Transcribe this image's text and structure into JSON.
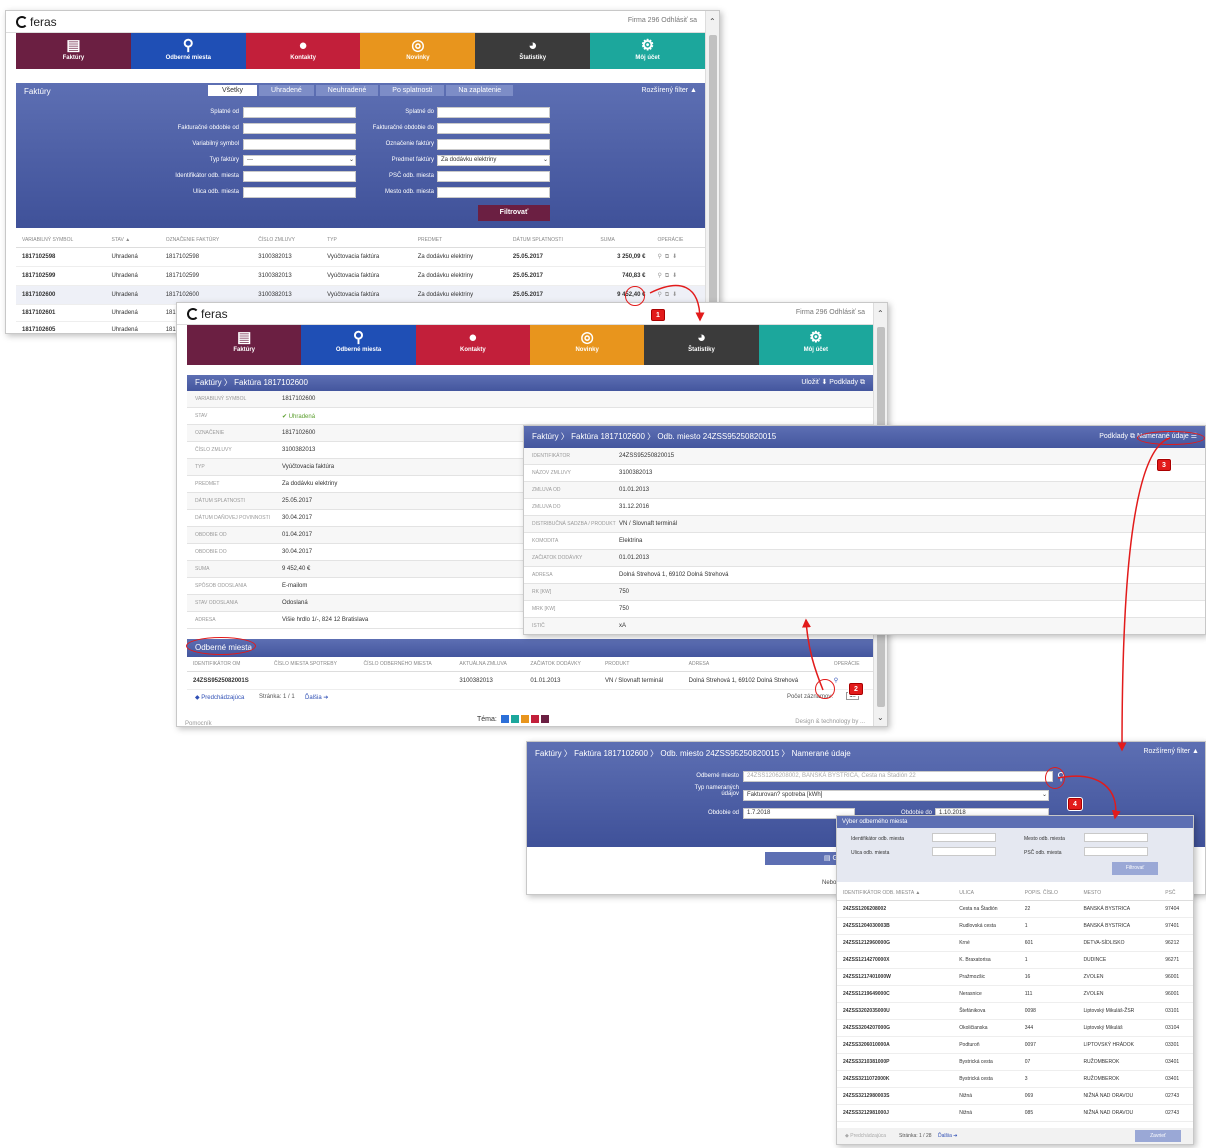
{
  "brand": "feras",
  "user_links": "Firma 296 Odhlásiť sa",
  "nav": [
    {
      "label": "Faktúry",
      "icon": "invoices-icon",
      "glyph": "▤",
      "color": "#6b1f42"
    },
    {
      "label": "Odberné miesta",
      "icon": "location-icon",
      "glyph": "⚲",
      "color": "#1f4fb5"
    },
    {
      "label": "Kontakty",
      "icon": "contact-icon",
      "glyph": "👤",
      "color": "#c21f3a"
    },
    {
      "label": "Novinky",
      "icon": "rss-icon",
      "glyph": "◎",
      "color": "#e8951d"
    },
    {
      "label": "Štatistiky",
      "icon": "pie-chart-icon",
      "glyph": "◕",
      "color": "#3b3b3b"
    },
    {
      "label": "Môj účet",
      "icon": "gears-icon",
      "glyph": "⚙",
      "color": "#1ca79c"
    }
  ],
  "s1": {
    "title": "Faktúry",
    "filter_label": "Rozšírený filter ▲",
    "tabs": [
      "Všetky",
      "Uhradené",
      "Neuhradené",
      "Po splatnosti",
      "Na zaplatenie"
    ],
    "labels_left": [
      "Splatné od",
      "Fakturačné obdobie od",
      "Variabilný symbol",
      "Typ faktúry",
      "Identifikátor odb. miesta",
      "Ulica odb. miesta"
    ],
    "labels_right": [
      "Splatné do",
      "Fakturačné obdobie do",
      "Označenie faktúry",
      "Predmet faktúry",
      "PSČ odb. miesta",
      "Mesto odb. miesta"
    ],
    "typ_value": "---",
    "predmet_value": "Za dodávku elektriny",
    "filter_button": "Filtrovať",
    "headers": [
      "VARIABILNÝ SYMBOL",
      "STAV ▲",
      "OZNAČENIE FAKTÚRY",
      "ČÍSLO ZMLUVY",
      "TYP",
      "PREDMET",
      "DÁTUM SPLATNOSTI",
      "SUMA",
      "OPERÁCIE"
    ],
    "rows": [
      [
        "1817102598",
        "Uhradená",
        "1817102598",
        "3100382013",
        "Vyúčtovacia faktúra",
        "Za dodávku elektriny",
        "25.05.2017",
        "3 250,09 €"
      ],
      [
        "1817102599",
        "Uhradená",
        "1817102599",
        "3100382013",
        "Vyúčtovacia faktúra",
        "Za dodávku elektriny",
        "25.05.2017",
        "740,83 €"
      ],
      [
        "1817102600",
        "Uhradená",
        "1817102600",
        "3100382013",
        "Vyúčtovacia faktúra",
        "Za dodávku elektriny",
        "25.05.2017",
        "9 452,40 €"
      ],
      [
        "1817102601",
        "Uhradená",
        "1817I",
        "",
        "",
        "",
        "",
        ""
      ],
      [
        "1817102605",
        "Uhradená",
        "1817I",
        "",
        "",
        "",
        "",
        ""
      ]
    ]
  },
  "s2": {
    "breadcrumb": "Faktúry  〉 Faktúra 1817102600",
    "actions": "Uložiť ⬇   Podklady ⧉",
    "details": [
      [
        "VARIABILNÝ SYMBOL",
        "1817102600"
      ],
      [
        "STAV",
        "✔ Uhradená"
      ],
      [
        "OZNAČENIE",
        "1817102600"
      ],
      [
        "ČÍSLO ZMLUVY",
        "3100382013"
      ],
      [
        "TYP",
        "Vyúčtovacia faktúra"
      ],
      [
        "PREDMET",
        "Za dodávku elektriny"
      ],
      [
        "DÁTUM SPLATNOSTI",
        "25.05.2017"
      ],
      [
        "DÁTUM DAŇOVEJ POVINNOSTI",
        "30.04.2017"
      ],
      [
        "OBDOBIE OD",
        "01.04.2017"
      ],
      [
        "OBDOBIE DO",
        "30.04.2017"
      ],
      [
        "SUMA",
        "9 452,40 €"
      ],
      [
        "SPÔSOB ODOSLANIA",
        "E-mailom"
      ],
      [
        "STAV ODOSLANIA",
        "Odoslaná"
      ],
      [
        "ADRESA",
        "Višie hrdlo 1/-, 824 12 Bratislava"
      ]
    ],
    "om_title": "Odberné miesta",
    "om_headers": [
      "IDENTIFIKÁTOR OM",
      "ČÍSLO MIESTA SPOTREBY",
      "ČÍSLO ODBERNÉHO MIESTA",
      "AKTUÁLNA ZMLUVA",
      "ZAČIATOK DODÁVKY",
      "PRODUKT",
      "ADRESA",
      "OPERÁCIE"
    ],
    "om_row": [
      "24ZSS9525082001S",
      "",
      "",
      "3100382013",
      "01.01.2013",
      "VN / Slovnaft terminál",
      "Dolná Strehová 1, 69102 Dolná Strehová"
    ],
    "pager_prev": "◆ Predchádzajúca",
    "pager_info": "Stránka: 1 / 1",
    "pager_next": "Ďalšia ➔",
    "per_page_label": "Počet záznamov:",
    "per_page": "10",
    "tema": "Téma:",
    "footer_left": "Pomocník",
    "footer_right": "Design & technology by ..."
  },
  "s3": {
    "breadcrumb": "Faktúry  〉 Faktúra 1817102600  〉 Odb. miesto 24ZSS95250820015",
    "actions_podklady": "Podklady ⧉",
    "actions_namerane": "Namerané údaje ☰",
    "details": [
      [
        "IDENTIFIKÁTOR",
        "24ZSS95250820015"
      ],
      [
        "NÁZOV ZMLUVY",
        "3100382013"
      ],
      [
        "ZMLUVA OD",
        "01.01.2013"
      ],
      [
        "ZMLUVA DO",
        "31.12.2016"
      ],
      [
        "DISTRIBUČNÁ SADZBA / PRODUKT",
        "VN / Slovnaft terminál"
      ],
      [
        "KOMODITA",
        "Elektrina"
      ],
      [
        "ZAČIATOK DODÁVKY",
        "01.01.2013"
      ],
      [
        "ADRESA",
        "Dolná Strehová 1, 69102 Dolná Strehová"
      ],
      [
        "RK [kW]",
        "750"
      ],
      [
        "MRK [kW]",
        "750"
      ],
      [
        "ISTIČ",
        "xA"
      ]
    ]
  },
  "s4": {
    "breadcrumb": "Faktúry  〉 Faktúra 1817102600  〉 Odb. miesto 24ZSS95250820015  〉 Namerané údaje",
    "filter_label": "Rozšírený filter ▲",
    "lbl_om": "Odberné miesto",
    "om_value": "24ZSS1206208002, BANSKÁ BYSTRICA, Cesta na Štadión 22",
    "lbl_typ": "Typ nameraných údajov",
    "typ_value": "Fakturovan? spotreba [kWh]",
    "lbl_od": "Obdobie od",
    "od_value": "1.7.2018",
    "lbl_do": "Obdobie do",
    "do_value": "1.10.2018",
    "graf_button": "▤ Graf",
    "neto": "Nebo"
  },
  "s5": {
    "title": "Výber odberného miesta",
    "lbl_id": "Identifikátor odb. miesta",
    "lbl_ulica": "Ulica odb. miesta",
    "lbl_mesto": "Mesto odb. miesta",
    "lbl_psc": "PSČ odb. miesta",
    "filter_button": "Filtrovať",
    "headers": [
      "IDENTIFIKÁTOR ODB. MIESTA ▲",
      "ULICA",
      "POPIS. ČÍSLO",
      "MESTO",
      "PSČ"
    ],
    "rows": [
      [
        "24ZSS1206208002",
        "Cesta na Štadión",
        "22",
        "BANSKÁ BYSTRICA",
        "97404"
      ],
      [
        "24ZSS1204030003B",
        "Rudlovská cesta",
        "1",
        "BANSKÁ BYSTRICA",
        "97401"
      ],
      [
        "24ZSS1212960000G",
        "Krné",
        "601",
        "DETVA-SÍDLISKO",
        "96212"
      ],
      [
        "24ZSS1214270000X",
        "K. Braxatorisa",
        "1",
        "DUDINCE",
        "96271"
      ],
      [
        "24ZSS1217401000W",
        "Pražmozšic",
        "16",
        "ZVOLEN",
        "96001"
      ],
      [
        "24ZSS1219649000C",
        "Nerasnice",
        "111",
        "ZVOLEN",
        "96001"
      ],
      [
        "24ZSS3202035000U",
        "Štefánikova",
        "0098",
        "Liptovský Mikuláš-ŽSR",
        "03101"
      ],
      [
        "24ZSS3204207000G",
        "Okoličianska",
        "344",
        "Liptovský Mikuláš",
        "03104"
      ],
      [
        "24ZSS3206010000A",
        "Podturoň",
        "0097",
        "LIPTOVSKÝ HRÁDOK",
        "03301"
      ],
      [
        "24ZSS3210381000P",
        "Bystrická cesta",
        "07",
        "RUŽOMBEROK",
        "03401"
      ],
      [
        "24ZSS3211072000K",
        "Bystrická cesta",
        "3",
        "RUŽOMBEROK",
        "03401"
      ],
      [
        "24ZSS3212980003S",
        "Nižná",
        "069",
        "NIŽNÁ NAD ORAVOU",
        "02743"
      ],
      [
        "24ZSS3212981000J",
        "Nižná",
        "085",
        "NIŽNÁ NAD ORAVOU",
        "02743"
      ]
    ],
    "pager_prev": "◆ Predchádzajúca",
    "pager_info": "Stránka: 1 / 28",
    "pager_next": "Ďalšia ➔",
    "close_button": "Zavrieť"
  },
  "steps": [
    "1",
    "2",
    "3",
    "4"
  ],
  "tema_colors": [
    "#2c6fd8",
    "#1ca79c",
    "#e8951d",
    "#c21f3a",
    "#6b1f42"
  ]
}
